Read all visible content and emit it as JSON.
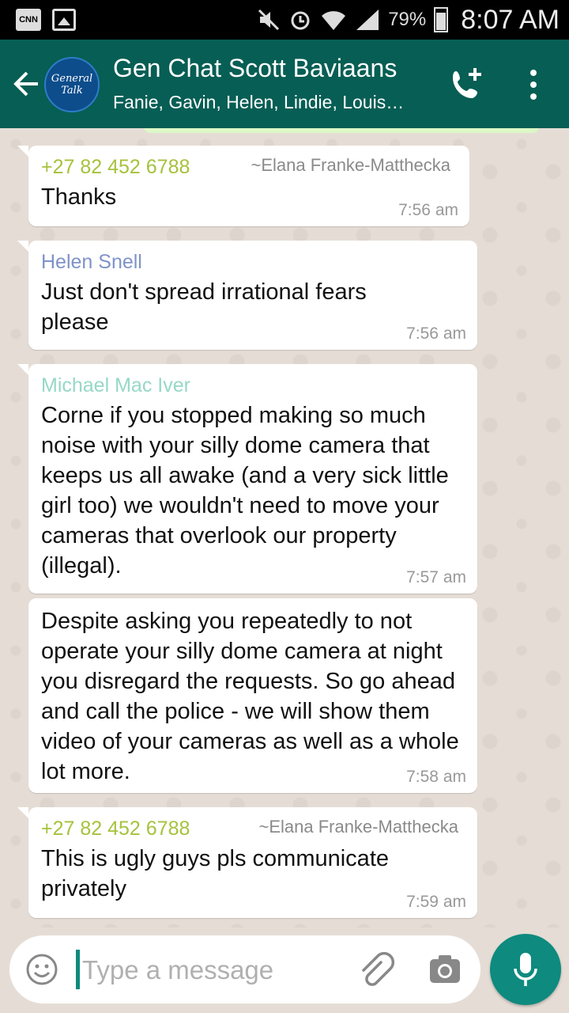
{
  "status_bar": {
    "left_badge": "CNN",
    "battery": "79%",
    "time": "8:07 AM"
  },
  "header": {
    "avatar_text": "General Talk",
    "title": "Gen Chat Scott Baviaans",
    "subtitle": "Fanie, Gavin, Helen, Lindie, Louis…"
  },
  "messages": [
    {
      "sender": "+27 82 452 6788",
      "sender_color": "#a5c23c",
      "sender_alt": "~Elana Franke-Matthecka",
      "text": "Thanks",
      "time": "7:56 am"
    },
    {
      "sender": "Helen Snell",
      "sender_color": "#7f93c8",
      "text": "Just don't spread irrational fears please",
      "time": "7:56 am"
    },
    {
      "sender": "Michael Mac Iver",
      "sender_color": "#96d8c6",
      "text": "Corne if you stopped making so much noise with your silly dome camera that keeps us all awake (and a very sick little girl too) we wouldn't need to move your cameras that overlook our property (illegal).",
      "time": "7:57 am"
    },
    {
      "text": "Despite asking you repeatedly to not operate your silly dome camera at night you disregard the requests. So go ahead and call the police - we will show them video of your cameras as well as a whole lot more.",
      "time": "7:58 am"
    },
    {
      "sender": "+27 82 452 6788",
      "sender_color": "#a5c23c",
      "sender_alt": "~Elana Franke-Matthecka",
      "text": "This is ugly guys pls communicate privately",
      "time": "7:59 am"
    }
  ],
  "composer": {
    "placeholder": "Type a message"
  },
  "colors": {
    "header": "#075e54",
    "accent": "#0e8a7f",
    "chat_bg": "#e5ddd5"
  }
}
